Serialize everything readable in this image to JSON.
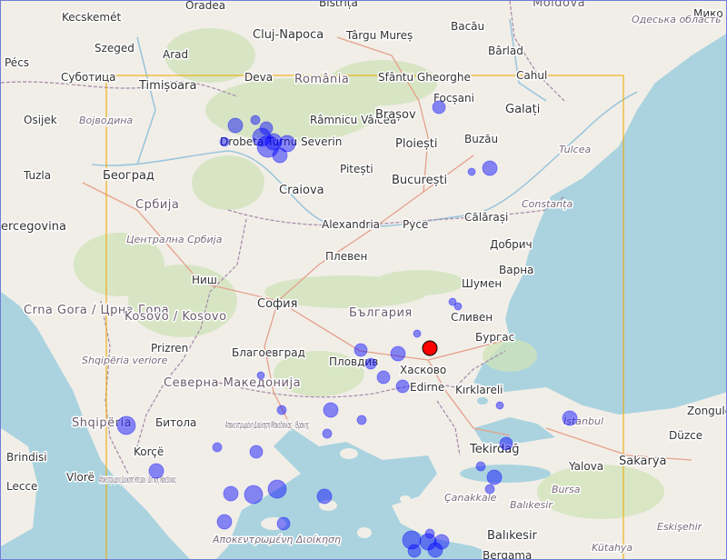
{
  "map": {
    "land_color": "#f1eee8",
    "water_color": "#aad3df",
    "bbox_color": "#f0a800",
    "event_color": "#0000ff",
    "main_event_color": "#ff0000"
  },
  "labels": {
    "oradea": "Oradea",
    "bistrita": "Bistrița",
    "moldova": "Moldova",
    "mikol": "Мико",
    "kecskemet": "Kecskemét",
    "cluj": "Cluj-Napoca",
    "targu_mures": "Târgu Mureș",
    "bacau": "Bacău",
    "odesa": "Одеська область",
    "szeged": "Szeged",
    "arad": "Arad",
    "deva": "Deva",
    "romania": "România",
    "sfantu": "Sfântu Gheorghe",
    "barlad": "Bârlad",
    "cahul": "Cahul",
    "pecs": "Pécs",
    "subotica": "Суботица",
    "timisoara": "Timișoara",
    "focsani": "Focșani",
    "galati": "Galați",
    "osijek": "Osijek",
    "vojvodina": "Војводина",
    "rm_valcea": "Râmnicu Vâlcea",
    "brasov": "Brașov",
    "drobeta": "Drobeta Turnu Severin",
    "ploiesti": "Ploiești",
    "buzau": "Buzău",
    "tulcea": "Tulcea",
    "tuzla": "Tuzla",
    "beograd": "Београд",
    "pitesti": "Pitești",
    "bucuresti": "București",
    "craiova": "Craiova",
    "constanta": "Constanța",
    "srbija": "Србија",
    "herzegovina": "ercegovina",
    "alexandria": "Alexandria",
    "ruse": "Русе",
    "calarasi": "Călărași",
    "dobrich": "Добрич",
    "central_serbia": "Централна Србија",
    "pleven": "Плевен",
    "varna": "Варна",
    "nis": "Ниш",
    "shumen": "Шумен",
    "crna_gora": "Crna Gora / Црна Гора",
    "sofia": "София",
    "kosovo": "Kosovo / Kosovo",
    "bulgaria": "България",
    "sliven": "Сливен",
    "burgas": "Бургас",
    "prizren": "Prizren",
    "blagoevgrad": "Благоевград",
    "plovdiv": "Пловдив",
    "haskovo": "Хасково",
    "shqiperia_veriore": "Shqipëria veriore",
    "severna_makedonija": "Северна Македонија",
    "edirne": "Edirne",
    "kirklareli": "Kırklareli",
    "shqiperia": "Shqipëria",
    "bitola": "Битола",
    "apok_macedonia_thrace": "Αποκεντρωμένη Διοίκηση Μακεδονίας - Θράκης",
    "istanbul": "İstanbul",
    "zonguldak": "Zongulda",
    "tekirdag": "Tekirdağ",
    "duzce": "Düzce",
    "korce": "Korçë",
    "brindisi": "Brindisi",
    "vlore": "Vlorë",
    "yalova": "Yalova",
    "sakarya": "Sakarya",
    "apok_epirus": "Αποκεντρωμένη Διοίκηση Ηπείρου - Δυτικής Μακεδονίας",
    "canakkale": "Çanakkale",
    "balikesir_region": "Balıkesir",
    "bursa": "Bursa",
    "lecce": "Lecce",
    "balikesir": "Balıkesir",
    "eskisehir": "Eskişehir",
    "apok_last": "Αποκεντρωμένη Διοίκηση",
    "kutahya": "Kütahya",
    "bergama": "Bergama"
  },
  "events": [
    {
      "id": "event-main",
      "lon": 26.05,
      "lat": 42.0
    }
  ]
}
